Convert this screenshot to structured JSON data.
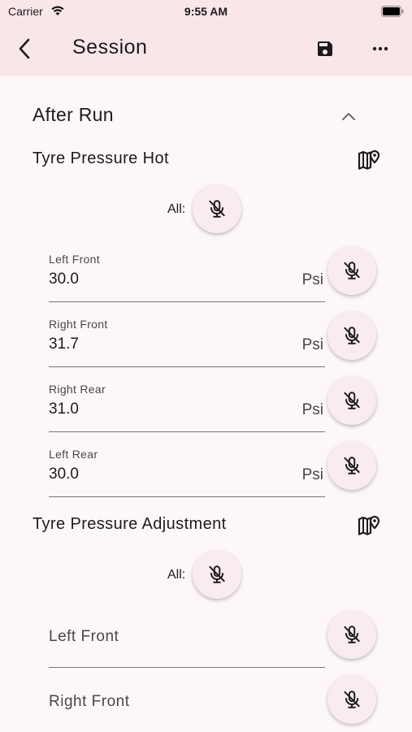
{
  "status_bar": {
    "carrier": "Carrier",
    "time": "9:55 AM"
  },
  "app_bar": {
    "title": "Session",
    "icons": [
      "back-arrow-icon",
      "save-icon",
      "more-horiz-icon"
    ]
  },
  "section": {
    "title": "After Run",
    "collapse_icon": "chevron-up-icon"
  },
  "tyre_pressure_hot": {
    "title": "Tyre Pressure Hot",
    "all_label": "All:",
    "fields": [
      {
        "label": "Left Front",
        "value": "30.0",
        "unit": "Psi"
      },
      {
        "label": "Right Front",
        "value": "31.7",
        "unit": "Psi"
      },
      {
        "label": "Right Rear",
        "value": "31.0",
        "unit": "Psi"
      },
      {
        "label": "Left Rear",
        "value": "30.0",
        "unit": "Psi"
      }
    ]
  },
  "tyre_pressure_adjustment": {
    "title": "Tyre Pressure Adjustment",
    "all_label": "All:",
    "fields": [
      {
        "label": "Left Front"
      },
      {
        "label": "Right Front"
      }
    ]
  },
  "colors": {
    "app_bar": "#f8e6e9",
    "background": "#fdf7f9",
    "mic_button": "#f8ecee"
  }
}
